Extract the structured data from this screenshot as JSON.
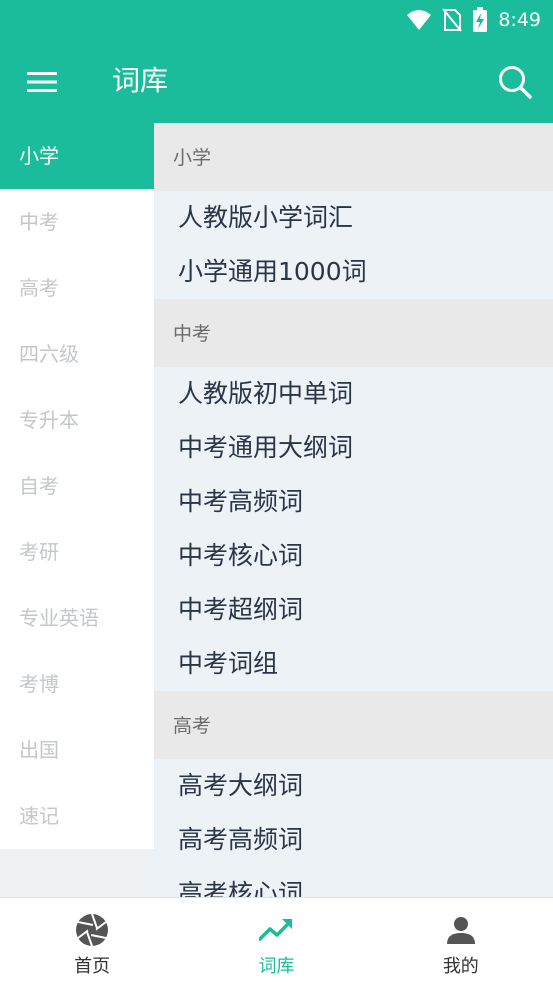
{
  "status_bar": {
    "time": "8:49"
  },
  "app_bar": {
    "title": "词库"
  },
  "colors": {
    "accent": "#1abc9c",
    "text": "#2a3546",
    "muted": "#c4c7ca"
  },
  "sidebar": {
    "items": [
      {
        "label": "小学",
        "active": true
      },
      {
        "label": "中考"
      },
      {
        "label": "高考"
      },
      {
        "label": "四六级"
      },
      {
        "label": "专升本"
      },
      {
        "label": "自考"
      },
      {
        "label": "考研"
      },
      {
        "label": "专业英语"
      },
      {
        "label": "考博"
      },
      {
        "label": "出国"
      },
      {
        "label": "速记"
      }
    ]
  },
  "sections": [
    {
      "title": "小学",
      "items": [
        "人教版小学词汇",
        "小学通用1000词"
      ]
    },
    {
      "title": "中考",
      "items": [
        "人教版初中单词",
        "中考通用大纲词",
        "中考高频词",
        "中考核心词",
        "中考超纲词",
        "中考词组"
      ]
    },
    {
      "title": "高考",
      "items": [
        "高考大纲词",
        "高考高频词",
        "高考核心词"
      ]
    }
  ],
  "bottom_nav": {
    "items": [
      {
        "label": "首页",
        "icon": "aperture-icon"
      },
      {
        "label": "词库",
        "icon": "trending-up-icon",
        "active": true
      },
      {
        "label": "我的",
        "icon": "person-icon"
      }
    ]
  }
}
